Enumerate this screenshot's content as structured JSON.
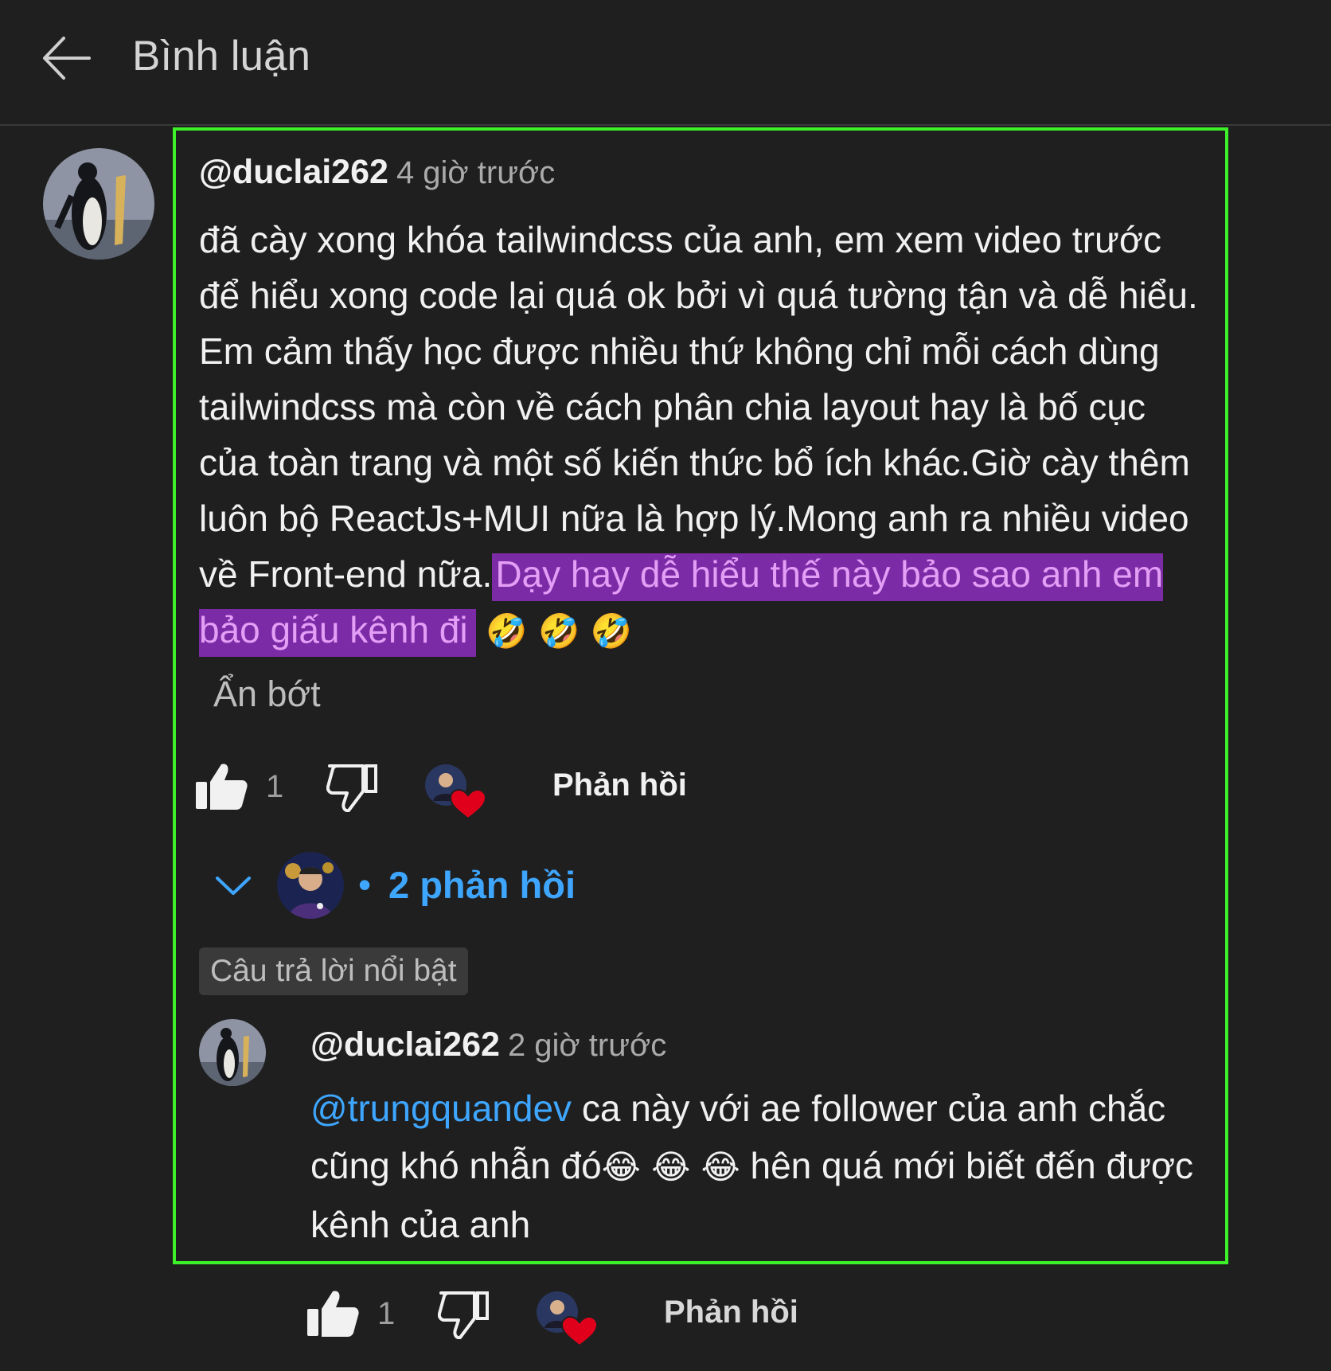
{
  "header": {
    "title": "Bình luận"
  },
  "comment": {
    "author": "@duclai262",
    "time": "4 giờ trước",
    "text_main": "đã cày xong khóa tailwindcss của anh, em xem video trước để hiểu xong code lại quá ok bởi vì quá tường tận và dễ hiểu. Em cảm thấy học được nhiều thứ không chỉ mỗi cách dùng tailwindcss mà còn về cách phân chia layout hay là bố cục của toàn trang và một số kiến thức bổ ích khác.Giờ cày thêm luôn bộ ReactJs+MUI nữa là hợp lý.Mong anh ra nhiều video về Front-end nữa.",
    "text_highlight": "Dạy hay dễ hiểu thế này bảo sao anh em bảo giấu kênh đi",
    "emojis": "🤣 🤣 🤣",
    "show_less": "Ẩn bớt",
    "like_count": "1",
    "reply_label": "Phản hồi",
    "replies_toggle": "2 phản hồi",
    "featured_label": "Câu trả lời nổi bật"
  },
  "reply": {
    "author": "@duclai262",
    "time": "2 giờ trước",
    "mention": "@trungquandev",
    "text_a": " ca này với ae follower của anh chắc cũng khó nhẫn đó",
    "emojis": "😂 😂 😂",
    "text_b": "  hên quá mới biết đến được kênh của anh",
    "like_count": "1",
    "reply_label": "Phản hồi"
  },
  "colors": {
    "highlight_border": "#3cf02a",
    "highlight_bg": "#7b2ba6",
    "link": "#3ea6ff",
    "heart": "#e0001b"
  },
  "icons": [
    "back-arrow-icon",
    "thumbs-up-icon",
    "thumbs-down-icon",
    "heart-icon",
    "chevron-down-icon"
  ]
}
